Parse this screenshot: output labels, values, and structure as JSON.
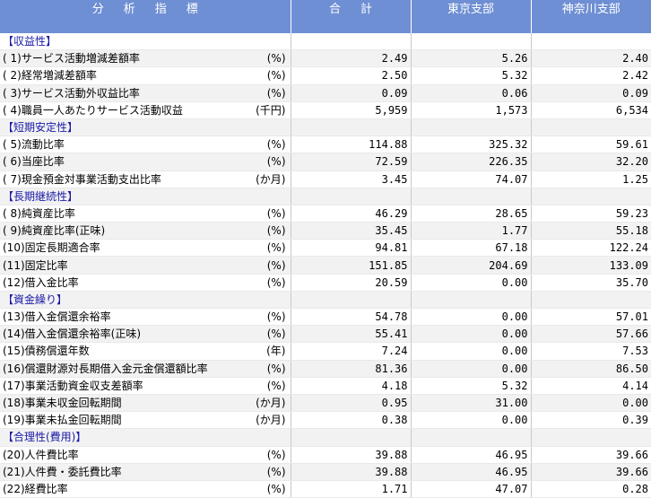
{
  "headers": [
    "分析指標",
    "合計",
    "東京支部",
    "神奈川支部"
  ],
  "sections": [
    {
      "title": "【収益性】",
      "rows": [
        {
          "label": "( 1)サービス活動増減差額率",
          "unit": "(%)",
          "values": [
            "2.49",
            "5.26",
            "2.40"
          ]
        },
        {
          "label": "( 2)経常増減差額率",
          "unit": "(%)",
          "values": [
            "2.50",
            "5.32",
            "2.42"
          ]
        },
        {
          "label": "( 3)サービス活動外収益比率",
          "unit": "(%)",
          "values": [
            "0.09",
            "0.06",
            "0.09"
          ]
        },
        {
          "label": "( 4)職員一人あたりサービス活動収益",
          "unit": "(千円)",
          "values": [
            "5,959",
            "1,573",
            "6,534"
          ]
        }
      ]
    },
    {
      "title": "【短期安定性】",
      "rows": [
        {
          "label": "( 5)流動比率",
          "unit": "(%)",
          "values": [
            "114.88",
            "325.32",
            "59.61"
          ]
        },
        {
          "label": "( 6)当座比率",
          "unit": "(%)",
          "values": [
            "72.59",
            "226.35",
            "32.20"
          ]
        },
        {
          "label": "( 7)現金預金対事業活動支出比率",
          "unit": "(か月)",
          "values": [
            "3.45",
            "74.07",
            "1.25"
          ]
        }
      ]
    },
    {
      "title": "【長期継続性】",
      "rows": [
        {
          "label": "( 8)純資産比率",
          "unit": "(%)",
          "values": [
            "46.29",
            "28.65",
            "59.23"
          ]
        },
        {
          "label": "( 9)純資産比率(正味)",
          "unit": "(%)",
          "values": [
            "35.45",
            "1.77",
            "55.18"
          ]
        },
        {
          "label": "(10)固定長期適合率",
          "unit": "(%)",
          "values": [
            "94.81",
            "67.18",
            "122.24"
          ]
        },
        {
          "label": "(11)固定比率",
          "unit": "(%)",
          "values": [
            "151.85",
            "204.69",
            "133.09"
          ]
        },
        {
          "label": "(12)借入金比率",
          "unit": "(%)",
          "values": [
            "20.59",
            "0.00",
            "35.70"
          ]
        }
      ]
    },
    {
      "title": "【資金繰り】",
      "rows": [
        {
          "label": "(13)借入金償還余裕率",
          "unit": "(%)",
          "values": [
            "54.78",
            "0.00",
            "57.01"
          ]
        },
        {
          "label": "(14)借入金償還余裕率(正味)",
          "unit": "(%)",
          "values": [
            "55.41",
            "0.00",
            "57.66"
          ]
        },
        {
          "label": "(15)債務償還年数",
          "unit": "(年)",
          "values": [
            "7.24",
            "0.00",
            "7.53"
          ]
        },
        {
          "label": "(16)償還財源対長期借入金元金償還額比率",
          "unit": "(%)",
          "values": [
            "81.36",
            "0.00",
            "86.50"
          ]
        },
        {
          "label": "(17)事業活動資金収支差額率",
          "unit": "(%)",
          "values": [
            "4.18",
            "5.32",
            "4.14"
          ]
        },
        {
          "label": "(18)事業未収金回転期間",
          "unit": "(か月)",
          "values": [
            "0.95",
            "31.00",
            "0.00"
          ]
        },
        {
          "label": "(19)事業未払金回転期間",
          "unit": "(か月)",
          "values": [
            "0.38",
            "0.00",
            "0.39"
          ]
        }
      ]
    },
    {
      "title": "【合理性(費用)】",
      "rows": [
        {
          "label": "(20)人件費比率",
          "unit": "(%)",
          "values": [
            "39.88",
            "46.95",
            "39.66"
          ]
        },
        {
          "label": "(21)人件費・委託費比率",
          "unit": "(%)",
          "values": [
            "39.88",
            "46.95",
            "39.66"
          ]
        },
        {
          "label": "(22)経費比率",
          "unit": "(%)",
          "values": [
            "1.71",
            "47.07",
            "0.28"
          ]
        }
      ]
    }
  ]
}
